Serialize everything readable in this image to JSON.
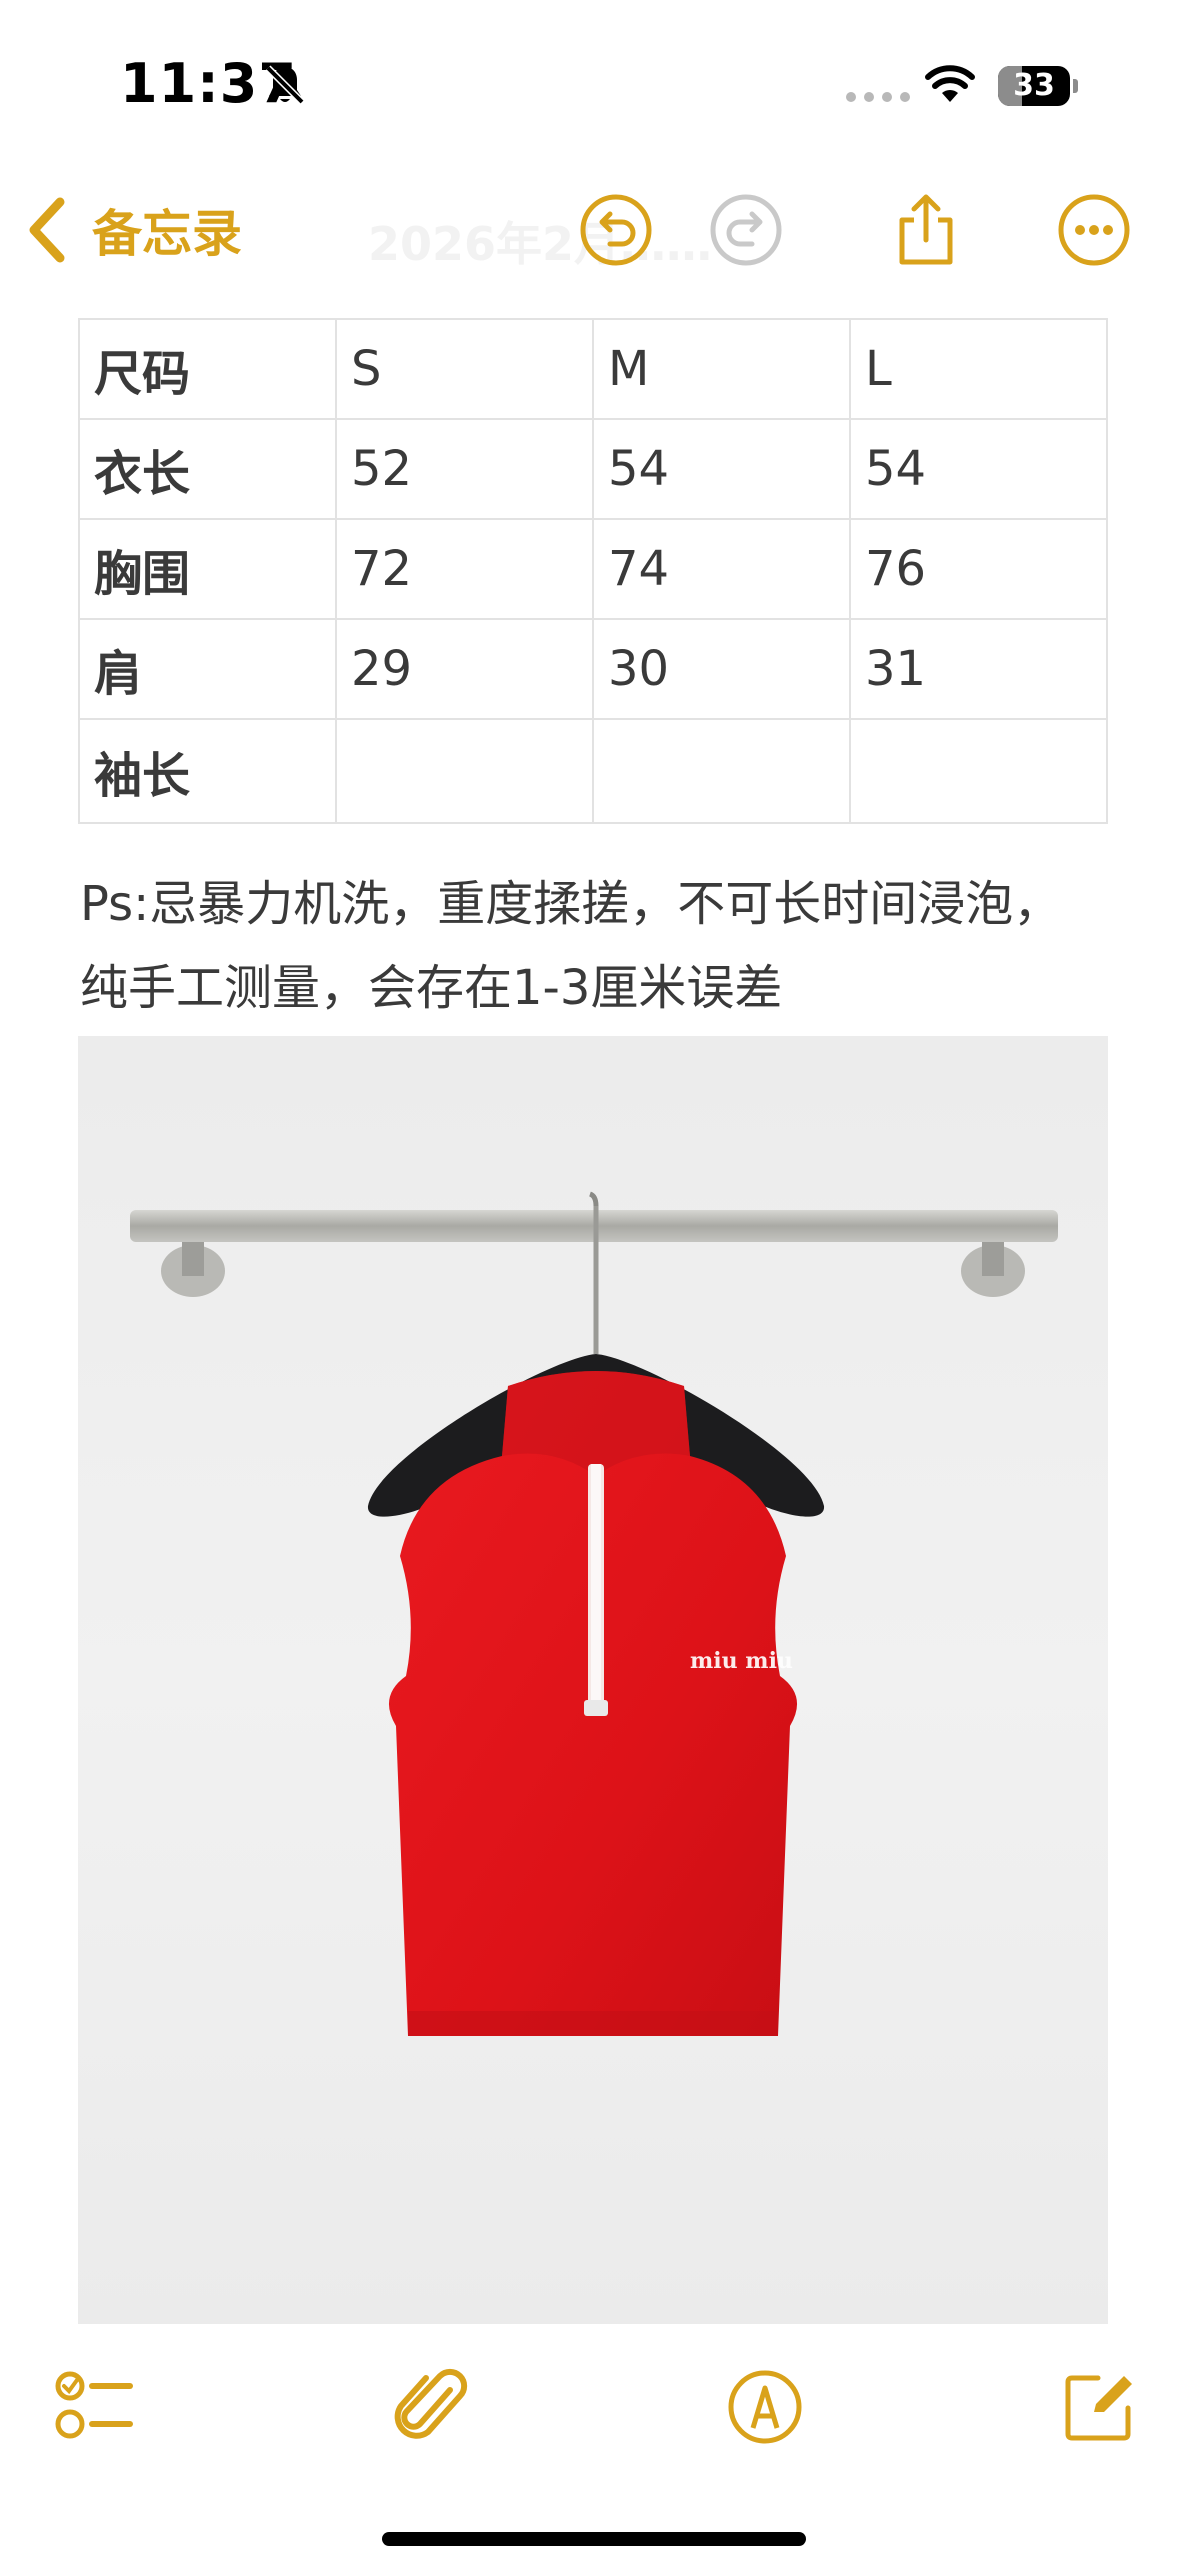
{
  "status_bar": {
    "time": "11:37",
    "battery_level": 33,
    "battery_label": "33",
    "icons": [
      "bell-slash-icon",
      "signal-dots-icon",
      "wifi-icon",
      "battery-icon"
    ]
  },
  "nav": {
    "back_label": "备忘录",
    "title": "2026年2月……",
    "icons": [
      "chevron-left-icon",
      "undo-icon",
      "redo-icon",
      "share-icon",
      "more-icon"
    ]
  },
  "size_table": {
    "headers": [
      "尺码",
      "S",
      "M",
      "L"
    ],
    "rows": [
      {
        "label": "衣长",
        "values": [
          "52",
          "54",
          "54"
        ]
      },
      {
        "label": "胸围",
        "values": [
          "72",
          "74",
          "76"
        ]
      },
      {
        "label": "肩",
        "values": [
          "29",
          "30",
          "31"
        ]
      },
      {
        "label": "袖长",
        "values": [
          "",
          "",
          ""
        ]
      }
    ]
  },
  "note": {
    "line1": "Ps:忌暴力机洗，重度揉搓，不可长时间浸泡，",
    "line2": "纯手工测量，会存在1-3厘米误差"
  },
  "photo": {
    "brand_text": "miu miu",
    "garment_color": "#e0131a"
  },
  "toolbar": {
    "icons": [
      "checklist-icon",
      "paperclip-icon",
      "markup-pen-icon",
      "compose-icon"
    ]
  },
  "colors": {
    "accent": "#d9a21b",
    "text": "#3a3a3a",
    "table_border": "#e2e2e2"
  }
}
